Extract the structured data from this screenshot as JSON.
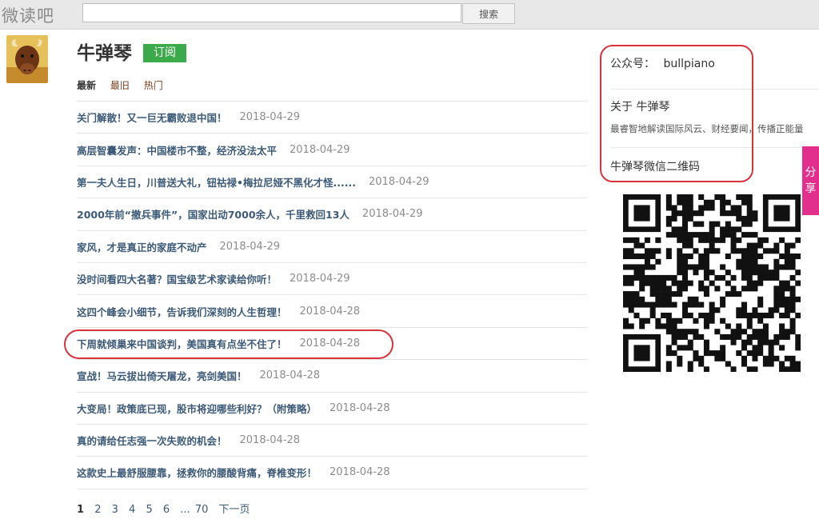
{
  "site": {
    "logo": "微读吧"
  },
  "search": {
    "placeholder": "",
    "button_label": "搜索"
  },
  "profile": {
    "name": "牛弹琴",
    "subscribe_label": "订阅",
    "tabs": [
      "最新",
      "最旧",
      "热门"
    ]
  },
  "articles": [
    {
      "title": "关门解散！又一巨无霸败退中国！",
      "date": "2018-04-29"
    },
    {
      "title": "高层智囊发声：中国楼市不整，经济没法太平",
      "date": "2018-04-29"
    },
    {
      "title": "第一夫人生日，川普送大礼，钮祜禄•梅拉尼娅不黑化才怪......",
      "date": "2018-04-29"
    },
    {
      "title": "2000年前“撤兵事件”，国家出动7000余人，千里救回13人",
      "date": "2018-04-29"
    },
    {
      "title": "家风，才是真正的家庭不动产",
      "date": "2018-04-29"
    },
    {
      "title": "没时间看四大名著？国宝级艺术家读给你听！",
      "date": "2018-04-29"
    },
    {
      "title": "这四个峰会小细节，告诉我们深刻的人生哲理！",
      "date": "2018-04-28"
    },
    {
      "title": "下周就倾巢来中国谈判，美国真有点坐不住了！",
      "date": "2018-04-28"
    },
    {
      "title": "宣战！马云拔出倚天屠龙，亮剑美国！",
      "date": "2018-04-28"
    },
    {
      "title": "大变局！政策底已现，股市将迎哪些利好？（附策略）",
      "date": "2018-04-28"
    },
    {
      "title": "真的请给任志强一次失败的机会！",
      "date": "2018-04-28"
    },
    {
      "title": "这款史上最舒服腰靠，拯救你的腰酸背痛，脊椎变形！",
      "date": "2018-04-28"
    }
  ],
  "pagination": {
    "pages": [
      "1",
      "2",
      "3",
      "4",
      "5",
      "6",
      "...",
      "70"
    ],
    "next": "下一页",
    "current": "1"
  },
  "sidebar": {
    "account_label": "公众号：",
    "account_id": "bullpiano",
    "about_label": "关于 牛弹琴",
    "description": "最睿智地解读国际风云、财经要闻，传播正能量",
    "qr_label": "牛弹琴微信二维码"
  },
  "share": {
    "label_top": "分",
    "label_bottom": "享"
  },
  "colors": {
    "accent_red": "#d8333d",
    "subscribe_green": "#3aaa4a",
    "share_pink": "#e22f8e",
    "link_blue": "#3c5a78"
  }
}
